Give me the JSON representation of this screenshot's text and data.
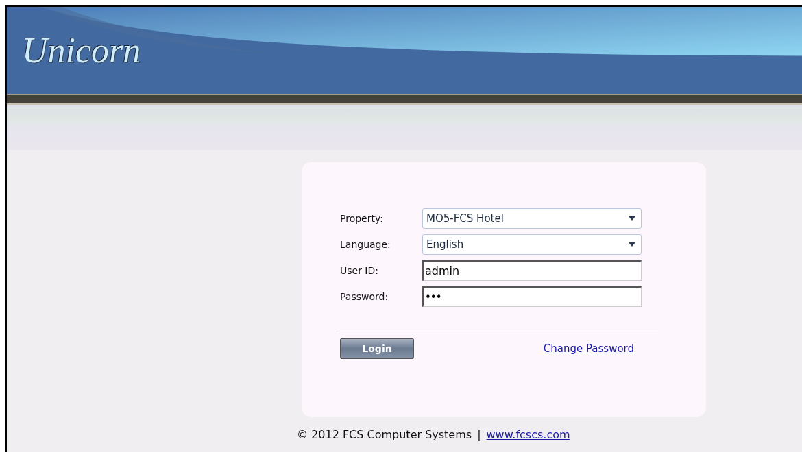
{
  "header": {
    "logo": "Unicorn"
  },
  "login_form": {
    "fields": [
      {
        "label": "Property:",
        "kind": "select",
        "value": "MO5-FCS Hotel"
      },
      {
        "label": "Language:",
        "kind": "select",
        "value": "English"
      },
      {
        "label": "User ID:",
        "kind": "text",
        "value": "admin"
      },
      {
        "label": "Password:",
        "kind": "password",
        "value": "•••"
      }
    ],
    "login_button": "Login",
    "change_password_link": "Change Password"
  },
  "footer": {
    "copyright": "© 2012 FCS Computer Systems",
    "separator": "|",
    "link": "www.fcscs.com"
  }
}
